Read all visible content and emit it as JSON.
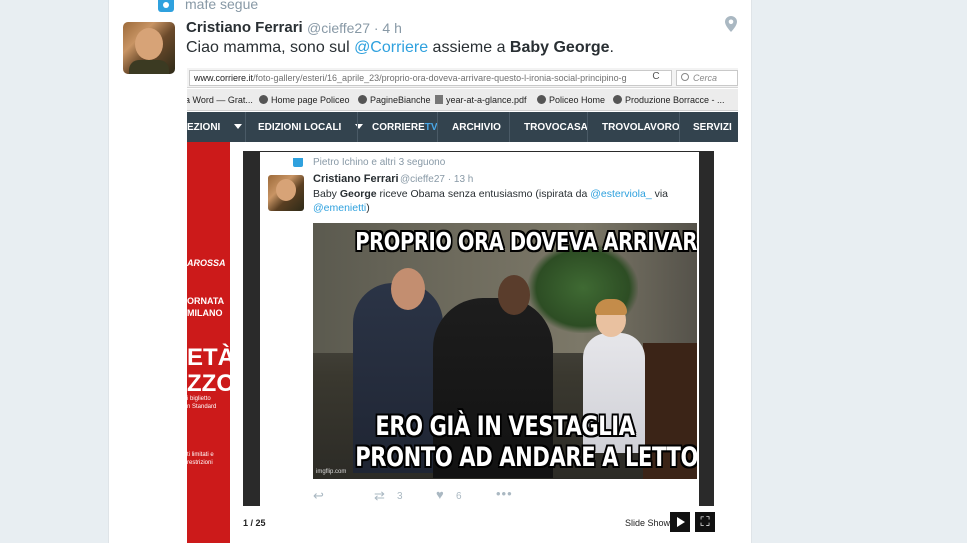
{
  "context": {
    "text": "mafe segue"
  },
  "tweet": {
    "name": "Cristiano Ferrari",
    "handle": "@cieffe27 · 4 h",
    "text_before": "Ciao mamma, sono sul ",
    "mention": "@Corriere",
    "text_middle": " assieme a ",
    "bold_text": "Baby George",
    "text_after": "."
  },
  "browser": {
    "url_host": "www.corriere.it",
    "url_path": "/foto-gallery/esteri/16_aprile_23/proprio-ora-doveva-arrivare-questo-l-ironia-social-principino-g",
    "reload_glyph": "C",
    "search_placeholder": "Cerca",
    "bookmarks": [
      "a Word — Grat...",
      "Home page Policeo",
      "PagineBianche",
      "year-at-a-glance.pdf",
      "Policeo Home",
      "Produzione Borracce - ..."
    ],
    "nav": [
      "EZIONI",
      "EDIZIONI LOCALI",
      "CORRIERE",
      "TV",
      "ARCHIVIO",
      "TROVOCASA",
      "TROVOLAVORO",
      "SERVIZI"
    ]
  },
  "sidebar_red": {
    "label1": "AROSSA",
    "label2a": "ORNATA",
    "label2b": "MILANO",
    "label3a": "ETÀ",
    "label3b": "ZZO",
    "label3c": "i biglietto",
    "label3d": "n Standard",
    "label4a": "ti limitati e",
    "label4b": "restrizioni"
  },
  "inner_tweet": {
    "context": "Pietro Ichino e altri 3 seguono",
    "name": "Cristiano Ferrari",
    "handle": "@cieffe27 · 13 h",
    "text1": "Baby ",
    "bold": "George",
    "text2": " riceve Obama senza entusiasmo (ispirata da ",
    "mention1": "@esterviola_",
    "text3": " via",
    "mention2": "@emenietti",
    "text4": ")",
    "meme_top": "PROPRIO ORA DOVEVA ARRIVARE QUESTO?",
    "meme_bottom1": "ERO GIÀ IN VESTAGLIA",
    "meme_bottom2": "PRONTO AD ANDARE A LETTO",
    "watermark": "imgflip.com",
    "reply_glyph": "↩",
    "rt_glyph": "⇄",
    "rt_count": "3",
    "fav_glyph": "♥",
    "fav_count": "6",
    "more_glyph": "•••"
  },
  "gallery": {
    "counter": "1 / 25",
    "slideshow_label": "Slide Show",
    "fullscreen_glyph": "⛶"
  }
}
